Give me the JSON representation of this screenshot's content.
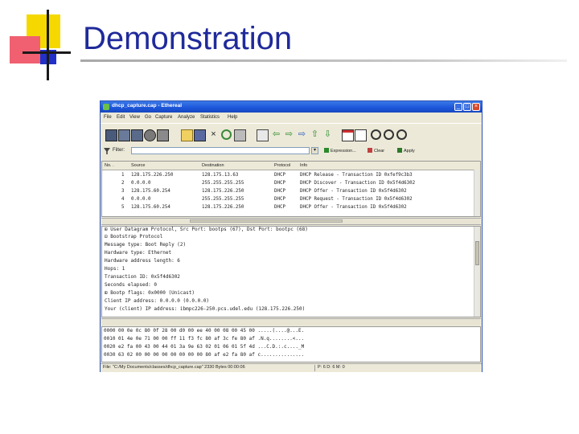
{
  "slide": {
    "title": "Demonstration",
    "accent_colors": {
      "yellow": "#f5d800",
      "red": "#f06070",
      "blue": "#2030c8",
      "title": "#1f2a9a"
    }
  },
  "window": {
    "title": "dhcp_capture.cap - Ethereal",
    "controls": {
      "minimize": "_",
      "maximize": "□",
      "close": "×"
    },
    "menus": [
      "File",
      "Edit",
      "View",
      "Go",
      "Capture",
      "Analyze",
      "Statistics",
      "Help"
    ],
    "toolbar_icons": [
      "interfaces-icon",
      "capture-options-icon",
      "start-capture-icon",
      "stop-capture-icon",
      "restart-capture-icon",
      "open-icon",
      "save-icon",
      "close-file-icon",
      "reload-icon",
      "print-icon",
      "find-icon",
      "go-back-icon",
      "go-forward-icon",
      "go-to-icon",
      "go-first-icon",
      "go-last-icon",
      "colorize-icon",
      "auto-scroll-icon",
      "zoom-in-icon",
      "zoom-out-icon",
      "zoom-normal-icon"
    ],
    "filter": {
      "label": "Filter:",
      "value": "",
      "expression_label": "Expression...",
      "clear_label": "Clear",
      "apply_label": "Apply"
    },
    "packet_list": {
      "columns": [
        "No. .",
        "Source",
        "Destination",
        "Protocol",
        "Info"
      ],
      "rows": [
        {
          "no": "1",
          "src": "128.175.226.250",
          "dst": "128.175.13.63",
          "proto": "DHCP",
          "info": "DHCP Release  - Transaction ID 0xfef9c3b3"
        },
        {
          "no": "2",
          "src": "0.0.0.0",
          "dst": "255.255.255.255",
          "proto": "DHCP",
          "info": "DHCP Discover - Transaction ID 0x5f4d6302"
        },
        {
          "no": "3",
          "src": "128.175.60.254",
          "dst": "128.175.226.250",
          "proto": "DHCP",
          "info": "DHCP Offer    - Transaction ID 0x5f4d6302"
        },
        {
          "no": "4",
          "src": "0.0.0.0",
          "dst": "255.255.255.255",
          "proto": "DHCP",
          "info": "DHCP Request  - Transaction ID 0x5f4d6302"
        },
        {
          "no": "5",
          "src": "128.175.60.254",
          "dst": "128.175.226.250",
          "proto": "DHCP",
          "info": "DHCP Offer    - Transaction ID 0x5f4d6302"
        }
      ]
    },
    "details": [
      "⊞ User Datagram Protocol, Src Port: bootps (67), Dst Port: bootpc (68)",
      "⊟ Bootstrap Protocol",
      "    Message type: Boot Reply (2)",
      "    Hardware type: Ethernet",
      "    Hardware address length: 6",
      "    Hops: 1",
      "    Transaction ID: 0x5f4d6302",
      "    Seconds elapsed: 0",
      "  ⊞ Bootp flags: 0x0000 (Unicast)",
      "    Client IP address: 0.0.0.0 (0.0.0.0)",
      "    Your (client) IP address: ibmpc226-250.pcs.udel.edu (128.175.226.250)"
    ],
    "hex_lines": [
      "0000  00 0e 0c 80 0f 28 00 d0  00 ee 40 00 08 00 45 00   .....(....@...E.",
      "0010  01 4e 0e 71 00 00 ff 11  f3 fc 80 af 3c fe 80 af   .N.q........<...",
      "0020  e2 fa 00 43 00 44 01 3a  9e 63 02 01 06 01 5f 4d   ...C.D.:.c...._M",
      "0030  63 02 00 00 00 00 00 00  00 00 80 af e2 fa 80 af   c..............."
    ],
    "status": {
      "left": "File: \"C:/My Documents/classes/dhcp_capture.cap\" 2330 Bytes 00:00:06",
      "right": "P: 6 D: 6 M: 0"
    }
  }
}
